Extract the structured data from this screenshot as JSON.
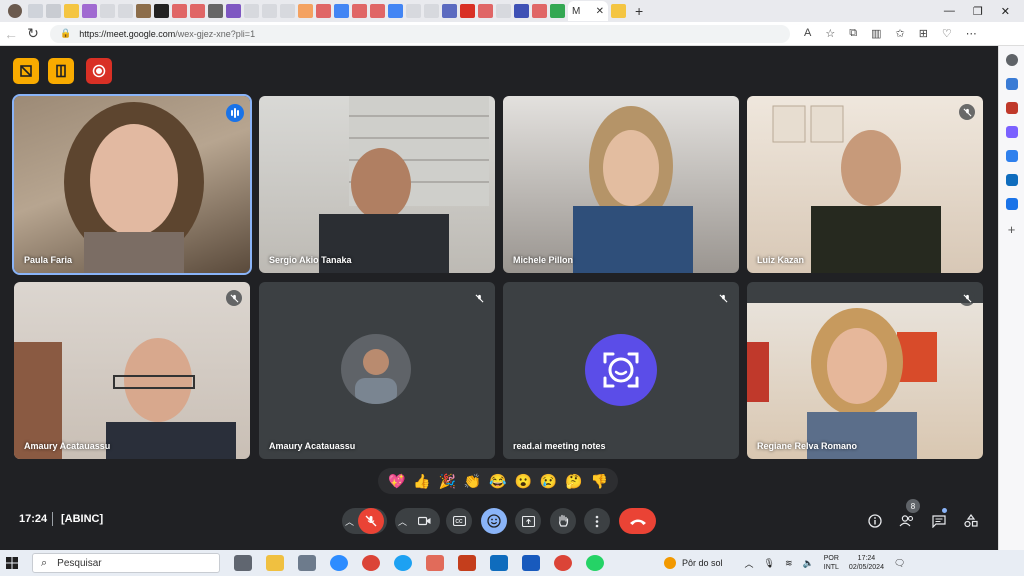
{
  "browser": {
    "active_tab_title": "M",
    "url_host": "https://meet.google.com",
    "url_path": "/wex-gjez-xne?pli=1"
  },
  "meeting": {
    "time": "17:24",
    "room_name": "[ABINC]",
    "participant_count": "8",
    "reactions": [
      "💖",
      "👍",
      "🎉",
      "👏",
      "😂",
      "😮",
      "😢",
      "🤔",
      "👎"
    ]
  },
  "participants": [
    {
      "name": "Paula Faria",
      "muted": false,
      "speaking": true
    },
    {
      "name": "Sergio Akio Tanaka",
      "muted": false,
      "speaking": false
    },
    {
      "name": "Michele Pillon",
      "muted": false,
      "speaking": false
    },
    {
      "name": "Luiz Kazan",
      "muted": true,
      "speaking": false
    },
    {
      "name": "Amaury Acatauassu",
      "muted": true,
      "speaking": false
    },
    {
      "name": "Amaury Acatauassu",
      "muted": true,
      "speaking": false
    },
    {
      "name": "read.ai meeting notes",
      "muted": true,
      "speaking": false
    },
    {
      "name": "Regiane Relva Romano",
      "muted": true,
      "speaking": false
    }
  ],
  "taskbar": {
    "search_placeholder": "Pesquisar",
    "weather": "Pôr do sol",
    "lang_top": "POR",
    "lang_bottom": "INTL",
    "clock_time": "17:24",
    "clock_date": "02/05/2024"
  },
  "colors": {
    "meet_bg": "#202124",
    "accent_blue": "#8ab4f8",
    "end_call_red": "#ea4335",
    "readai_purple": "#5b4de8"
  }
}
